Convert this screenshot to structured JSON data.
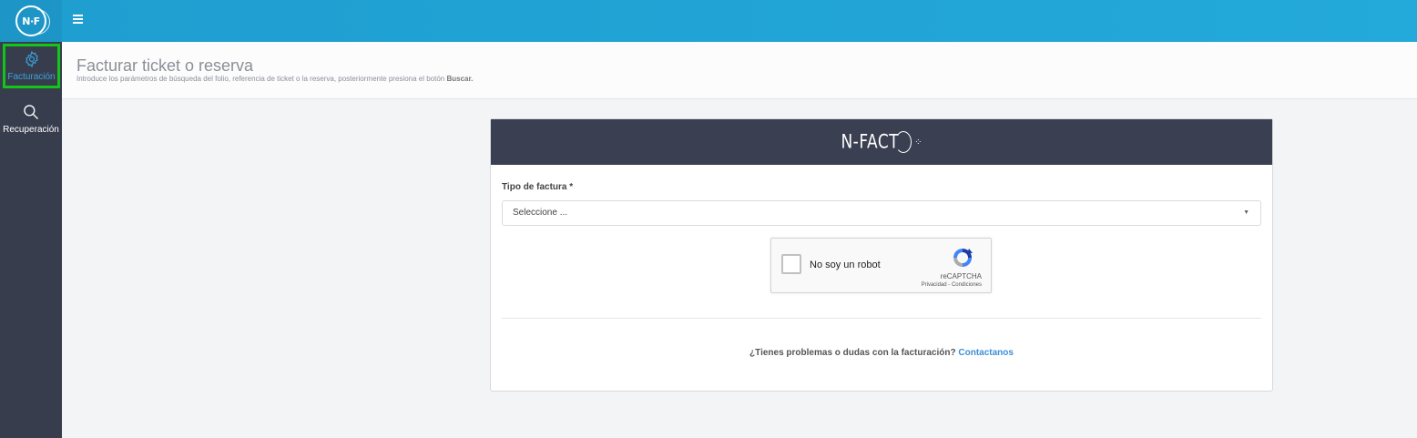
{
  "header": {
    "logo_text": "N·F",
    "menu_icon": "hamburger-icon"
  },
  "sidebar": {
    "items": [
      {
        "label": "Facturación",
        "icon": "gear-icon",
        "active": true
      },
      {
        "label": "Recuperación",
        "icon": "search-icon",
        "active": false
      }
    ]
  },
  "page": {
    "title": "Facturar ticket o reserva",
    "subtitle_prefix": "Introduce los parámetros de búsqueda del folio, referencia de ticket o la reserva, posteriormente presiona el botón",
    "subtitle_bold": "Buscar."
  },
  "card": {
    "brand": "N-FACT",
    "field_label": "Tipo de factura *",
    "select_value": "Seleccione ...",
    "captcha": {
      "label": "No soy un robot",
      "brand": "reCAPTCHA",
      "links": "Privacidad - Condiciones"
    },
    "help_text": "¿Tienes problemas o dudas con la facturación?",
    "help_link": "Contactanos"
  },
  "colors": {
    "topbar": "#23a9da",
    "sidebar": "#383d4e",
    "active_outline": "#13c41b",
    "card_header": "#3a3f51",
    "link": "#3c8fd6"
  }
}
